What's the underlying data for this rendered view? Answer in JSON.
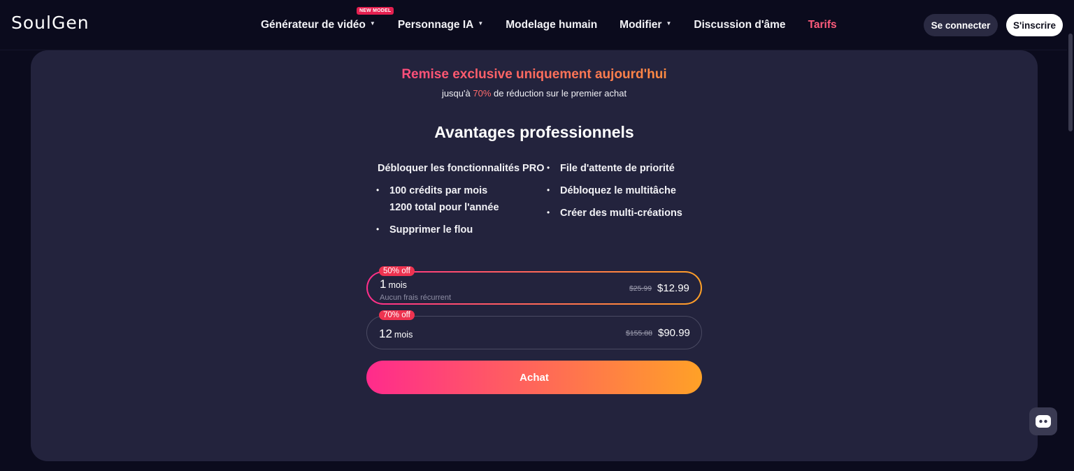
{
  "header": {
    "logo": "SoulGen",
    "nav": [
      {
        "label": "Générateur de vidéo",
        "dropdown": true,
        "badge": "NEW MODEL"
      },
      {
        "label": "Personnage IA",
        "dropdown": true
      },
      {
        "label": "Modelage humain",
        "dropdown": false
      },
      {
        "label": "Modifier",
        "dropdown": true
      },
      {
        "label": "Discussion d'âme",
        "dropdown": false
      },
      {
        "label": "Tarifs",
        "dropdown": false,
        "active": true
      }
    ],
    "login_label": "Se connecter",
    "signup_label": "S'inscrire"
  },
  "promo": {
    "title": "Remise exclusive uniquement aujourd'hui",
    "sub_prefix": "jusqu'à",
    "sub_pct": "70%",
    "sub_suffix": "de réduction sur le premier achat"
  },
  "advantages": {
    "title": "Avantages professionnels",
    "left": {
      "heading": "Débloquer les fonctionnalités PRO",
      "items": [
        "100 crédits par mois",
        "1200 total pour l'année",
        "Supprimer le flou"
      ]
    },
    "right": {
      "items": [
        "File d'attente de priorité",
        "Débloquez le multitâche",
        "Créer des multi-créations"
      ]
    }
  },
  "plans": [
    {
      "badge": "50% off",
      "num": "1",
      "unit": "mois",
      "note": "Aucun frais récurrent",
      "old_price": "$25.99",
      "price": "$12.99",
      "selected": true
    },
    {
      "badge": "70% off",
      "num": "12",
      "unit": "mois",
      "note": "",
      "old_price": "$155.88",
      "price": "$90.99",
      "selected": false
    }
  ],
  "buy_label": "Achat",
  "colors": {
    "background": "#0b0b1d",
    "card": "#23233d",
    "accent_pink": "#ff2b8c",
    "accent_orange": "#ffa127",
    "active_nav": "#ff5c7c"
  },
  "icons": {
    "chat": "chat-bot-icon",
    "caret": "chevron-down-icon"
  }
}
